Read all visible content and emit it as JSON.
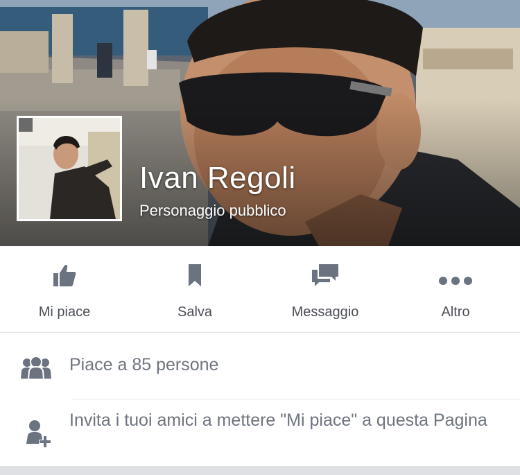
{
  "page": {
    "name": "Ivan Regoli",
    "category": "Personaggio pubblico"
  },
  "actions": [
    {
      "label": "Mi piace",
      "icon": "thumbs-up-icon"
    },
    {
      "label": "Salva",
      "icon": "bookmark-icon"
    },
    {
      "label": "Messaggio",
      "icon": "chat-bubbles-icon"
    },
    {
      "label": "Altro",
      "icon": "more-dots-icon"
    }
  ],
  "info": {
    "likes_text": "Piace a 85 persone",
    "invite_text": "Invita i tuoi amici a mettere \"Mi piace\" a questa Pagina"
  },
  "colors": {
    "icon_gray": "#6b7280",
    "label_gray": "#4b4f56",
    "row_text": "#6e7480",
    "divider": "#e5e6e9"
  }
}
